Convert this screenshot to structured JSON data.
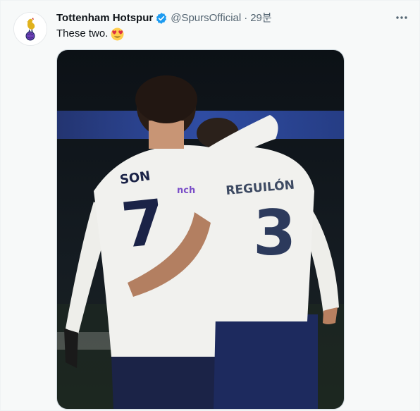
{
  "tweet": {
    "display_name": "Tottenham Hotspur",
    "handle": "@SpursOfficial",
    "separator": "·",
    "time": "29분",
    "text": "These two.",
    "text_emoji": "heart-eyes-emoji-icon",
    "verified_icon": "verified-badge-icon",
    "more_icon": "more-options-icon",
    "avatar_icon": "spurs-cockerel-logo-icon"
  },
  "media": {
    "left_player": {
      "name": "SON",
      "number": "7"
    },
    "right_player": {
      "name": "REGUILÓN",
      "number": "3"
    },
    "colors": {
      "kit_white": "#f1f1ee",
      "kit_navy": "#1b2347",
      "background_dark": "#121820",
      "stadium_board": "#2f4fb0"
    }
  },
  "colors": {
    "text_primary": "#0f1419",
    "text_secondary": "#536471",
    "verified_blue": "#1d9bf0",
    "spurs_navy": "#132257"
  }
}
